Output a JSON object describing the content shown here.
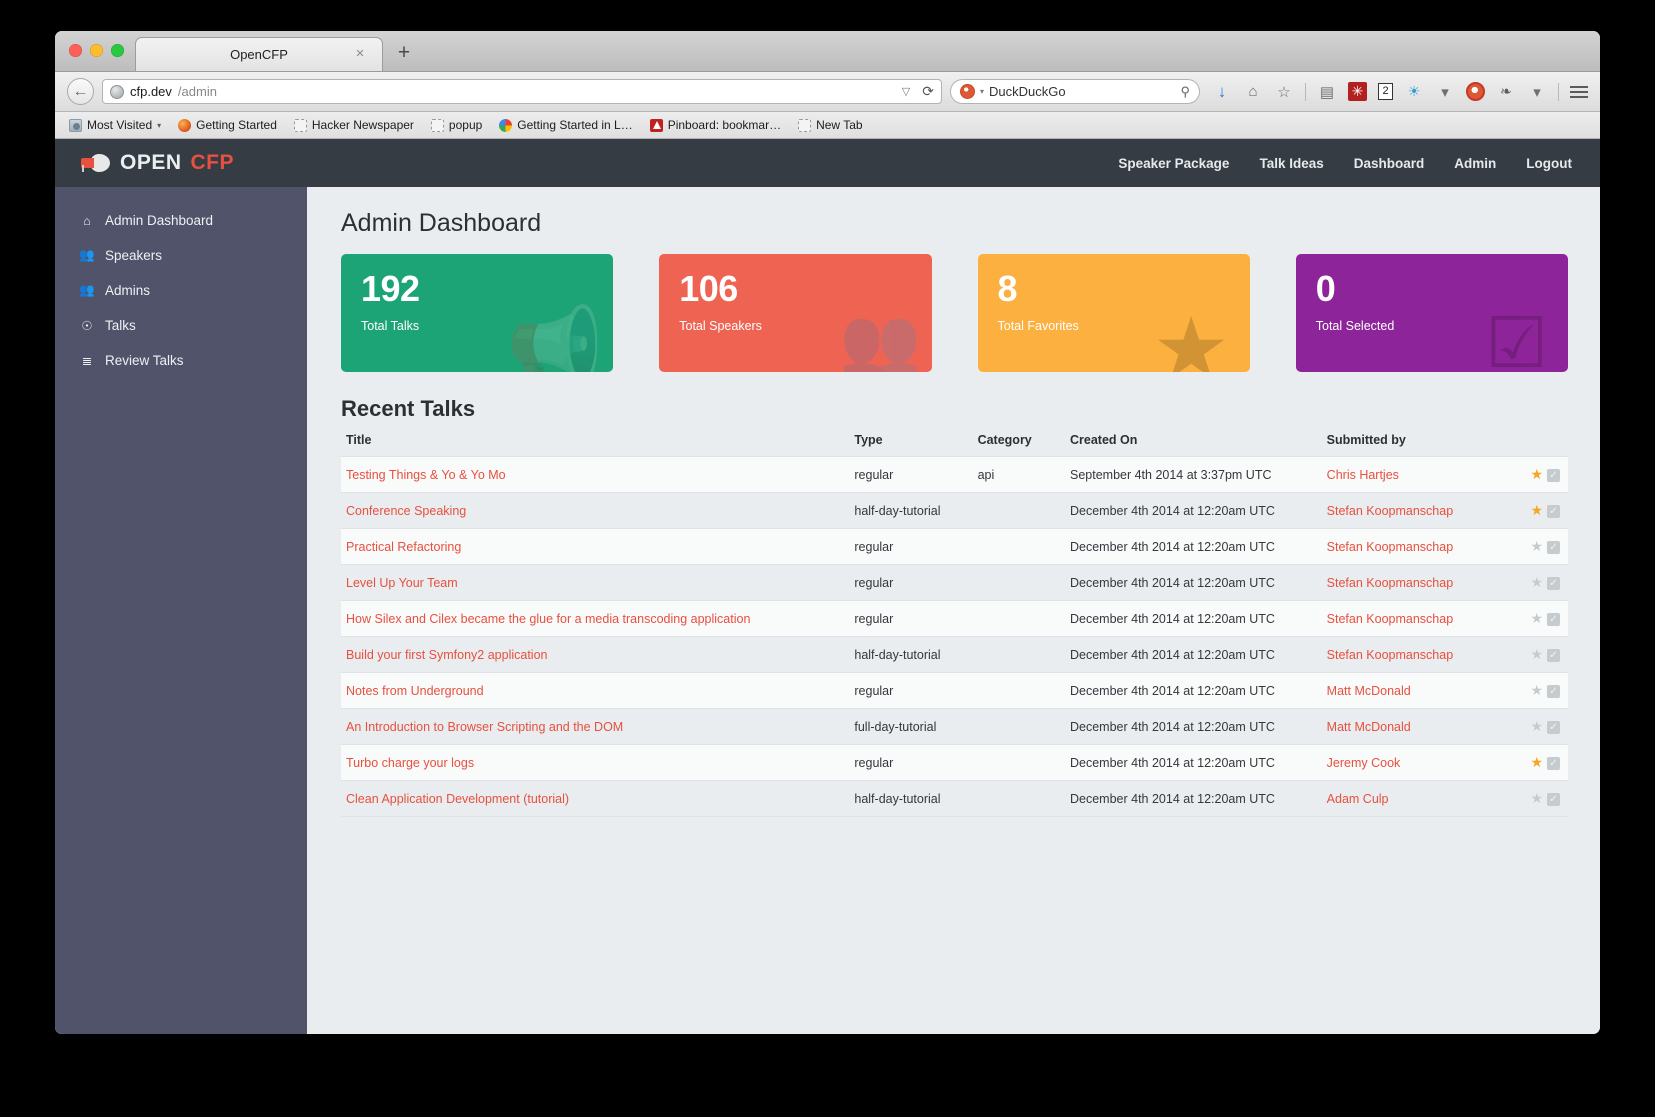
{
  "browser": {
    "tab_title": "OpenCFP",
    "tab_close_glyph": "×",
    "new_tab_glyph": "+",
    "back_glyph": "←",
    "url_host": "cfp.dev",
    "url_path": "/admin",
    "url_caret": "▽",
    "reload_glyph": "⟳",
    "search_engine": "DuckDuckGo",
    "search_caret": "▾",
    "search_glyph": "⚲",
    "toolbar_icons": {
      "download": "↓",
      "home": "⌂",
      "bookmark_star": "☆",
      "reader": "▤",
      "badge_red": "✳",
      "counter": "2",
      "blue_gear": "☀",
      "caret": "▾",
      "ddg_privacy": "",
      "fly": "❧",
      "caret2": "▾"
    },
    "bookmarks": [
      {
        "label": "Most Visited",
        "icon": "folderish",
        "caret": "▾"
      },
      {
        "label": "Getting Started",
        "icon": "firefox",
        "caret": ""
      },
      {
        "label": "Hacker Newspaper",
        "icon": "dashed",
        "caret": ""
      },
      {
        "label": "popup",
        "icon": "dashed",
        "caret": ""
      },
      {
        "label": "Getting Started in L…",
        "icon": "google",
        "caret": ""
      },
      {
        "label": "Pinboard: bookmar…",
        "icon": "pinboard",
        "caret": ""
      },
      {
        "label": "New Tab",
        "icon": "dashed",
        "caret": ""
      }
    ]
  },
  "topnav": {
    "brand_open": "OPEN",
    "brand_cfp": "CFP",
    "links": [
      {
        "label": "Speaker Package",
        "active": false
      },
      {
        "label": "Talk Ideas",
        "active": false
      },
      {
        "label": "Dashboard",
        "active": false
      },
      {
        "label": "Admin",
        "active": true
      },
      {
        "label": "Logout",
        "active": false
      }
    ]
  },
  "sidebar": {
    "items": [
      {
        "label": "Admin Dashboard",
        "icon": "home-icon",
        "glyph": "⌂"
      },
      {
        "label": "Speakers",
        "icon": "users-icon",
        "glyph": "♟♟"
      },
      {
        "label": "Admins",
        "icon": "users-icon",
        "glyph": "♟♟"
      },
      {
        "label": "Talks",
        "icon": "microphone-icon",
        "glyph": "♁"
      },
      {
        "label": "Review Talks",
        "icon": "list-icon",
        "glyph": "☰"
      }
    ]
  },
  "main": {
    "page_title": "Admin Dashboard",
    "cards": [
      {
        "value": "192",
        "label": "Total Talks",
        "color": "#1ca477",
        "icon": "megaphone-icon",
        "glyph": "📣"
      },
      {
        "value": "106",
        "label": "Total Speakers",
        "color": "#ee6352",
        "icon": "users-icon",
        "glyph": "👥"
      },
      {
        "value": "8",
        "label": "Total Favorites",
        "color": "#fbb03f",
        "icon": "star-icon",
        "glyph": "★"
      },
      {
        "value": "0",
        "label": "Total Selected",
        "color": "#8e2499",
        "icon": "check-square-icon",
        "glyph": "☑"
      }
    ],
    "section_title": "Recent Talks",
    "table": {
      "columns": [
        "Title",
        "Type",
        "Category",
        "Created On",
        "Submitted by",
        ""
      ],
      "rows": [
        {
          "title": "Testing Things & Yo & Yo Mo",
          "type": "regular",
          "category": "api",
          "created": "September 4th 2014 at 3:37pm UTC",
          "by": "Chris Hartjes",
          "favorite": true
        },
        {
          "title": "Conference Speaking",
          "type": "half-day-tutorial",
          "category": "",
          "created": "December 4th 2014 at 12:20am UTC",
          "by": "Stefan Koopmanschap",
          "favorite": true
        },
        {
          "title": "Practical Refactoring",
          "type": "regular",
          "category": "",
          "created": "December 4th 2014 at 12:20am UTC",
          "by": "Stefan Koopmanschap",
          "favorite": false
        },
        {
          "title": "Level Up Your Team",
          "type": "regular",
          "category": "",
          "created": "December 4th 2014 at 12:20am UTC",
          "by": "Stefan Koopmanschap",
          "favorite": false
        },
        {
          "title": "How Silex and Cilex became the glue for a media transcoding application",
          "type": "regular",
          "category": "",
          "created": "December 4th 2014 at 12:20am UTC",
          "by": "Stefan Koopmanschap",
          "favorite": false
        },
        {
          "title": "Build your first Symfony2 application",
          "type": "half-day-tutorial",
          "category": "",
          "created": "December 4th 2014 at 12:20am UTC",
          "by": "Stefan Koopmanschap",
          "favorite": false
        },
        {
          "title": "Notes from Underground",
          "type": "regular",
          "category": "",
          "created": "December 4th 2014 at 12:20am UTC",
          "by": "Matt McDonald",
          "favorite": false
        },
        {
          "title": "An Introduction to Browser Scripting and the DOM",
          "type": "full-day-tutorial",
          "category": "",
          "created": "December 4th 2014 at 12:20am UTC",
          "by": "Matt McDonald",
          "favorite": false
        },
        {
          "title": "Turbo charge your logs",
          "type": "regular",
          "category": "",
          "created": "December 4th 2014 at 12:20am UTC",
          "by": "Jeremy Cook",
          "favorite": true
        },
        {
          "title": "Clean Application Development (tutorial)",
          "type": "half-day-tutorial",
          "category": "",
          "created": "December 4th 2014 at 12:20am UTC",
          "by": "Adam Culp",
          "favorite": false
        }
      ]
    }
  },
  "colors": {
    "brand_red": "#e8503f",
    "navbar_dark": "#353c44",
    "sidebar": "#50536a",
    "content_bg": "#e9edef",
    "star_on": "#f5a623",
    "star_off": "#c6cbce"
  }
}
